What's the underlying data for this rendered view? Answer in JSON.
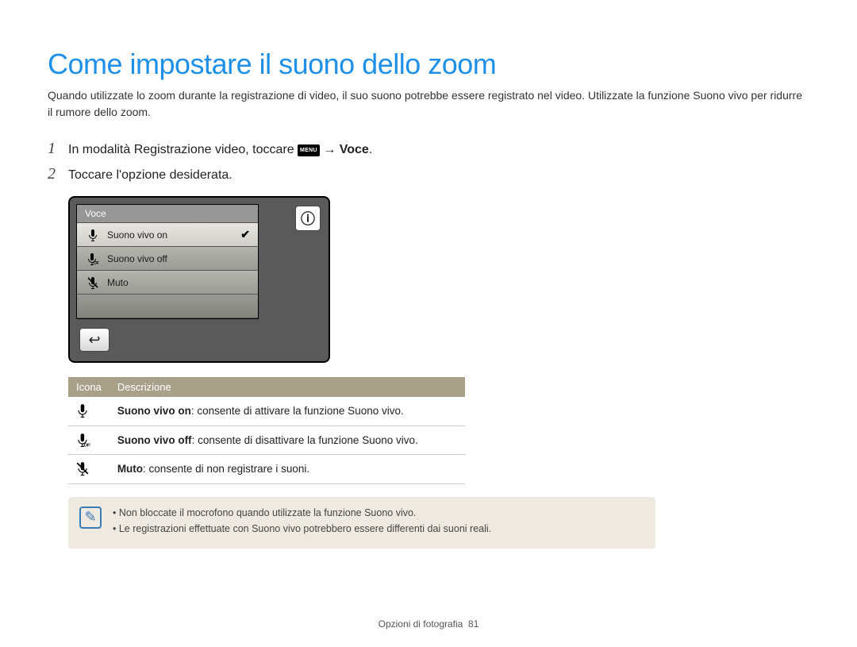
{
  "title": "Come impostare il suono dello zoom",
  "intro": "Quando utilizzate lo zoom durante la registrazione di video, il suo suono potrebbe essere registrato nel video. Utilizzate la funzione Suono vivo per ridurre il rumore dello zoom.",
  "steps": {
    "s1_pre": "In modalità Registrazione video, toccare ",
    "s1_menu": "MENU",
    "s1_arrow": " → ",
    "s1_bold": "Voce",
    "s1_end": ".",
    "s2": "Toccare l'opzione desiderata."
  },
  "menu": {
    "header": "Voce",
    "items": [
      {
        "label": "Suono vivo on",
        "selected": true
      },
      {
        "label": "Suono vivo off",
        "selected": false
      },
      {
        "label": "Muto",
        "selected": false
      }
    ]
  },
  "table": {
    "col1": "Icona",
    "col2": "Descrizione",
    "rows": [
      {
        "bold": "Suono vivo on",
        "rest": ": consente di attivare la funzione Suono vivo."
      },
      {
        "bold": "Suono vivo off",
        "rest": ": consente di disattivare la funzione Suono vivo."
      },
      {
        "bold": "Muto",
        "rest": ": consente di non registrare i suoni."
      }
    ]
  },
  "note": {
    "items": [
      "Non bloccate il mocrofono quando utilizzate la funzione Suono vivo.",
      "Le registrazioni effettuate con Suono vivo potrebbero essere differenti dai suoni reali."
    ]
  },
  "footer": {
    "section": "Opzioni di fotografia",
    "page": "81"
  }
}
